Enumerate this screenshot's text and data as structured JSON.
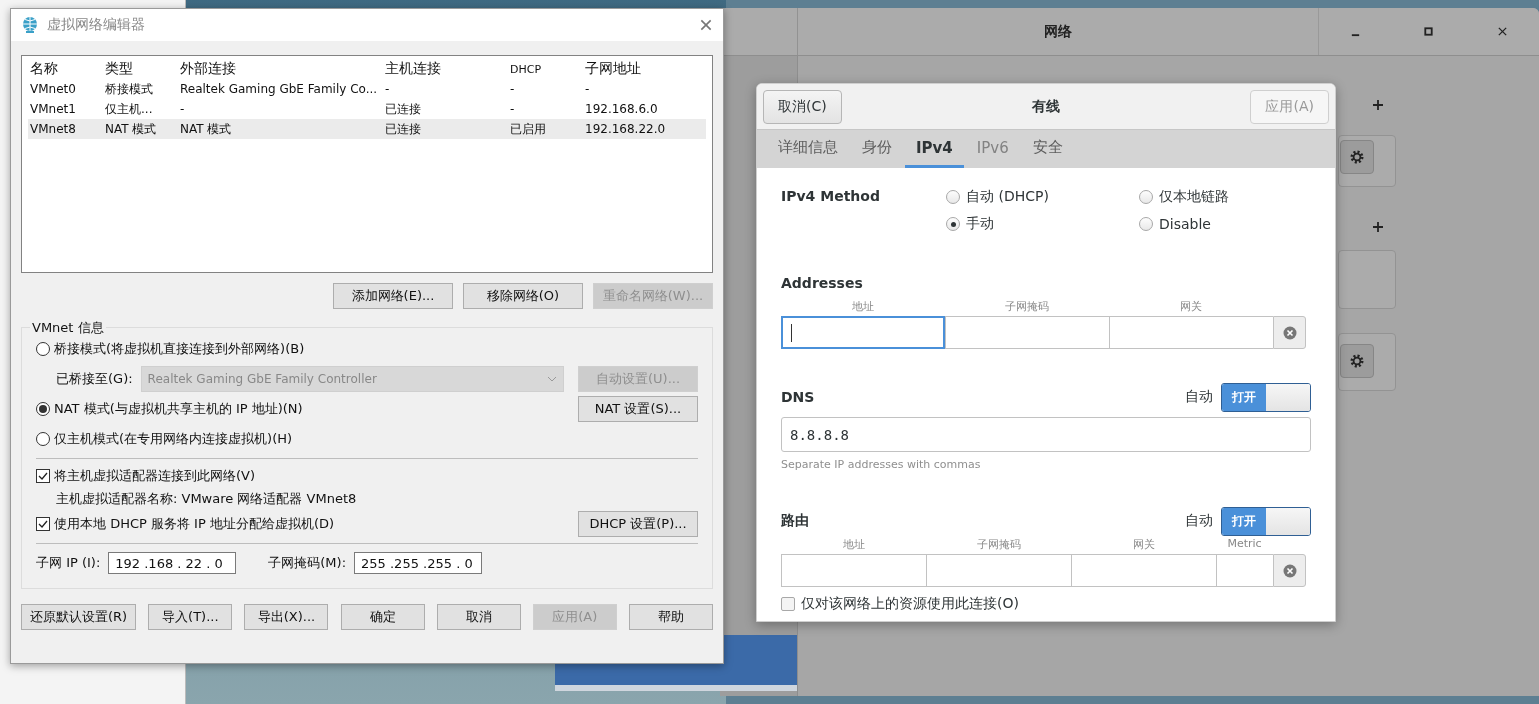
{
  "network_window": {
    "title": "网络"
  },
  "vnet_editor": {
    "title": "虚拟网络编辑器",
    "columns": [
      "名称",
      "类型",
      "外部连接",
      "主机连接",
      "DHCP",
      "子网地址"
    ],
    "rows": [
      {
        "cells": [
          "VMnet0",
          "桥接模式",
          "Realtek Gaming GbE Family Co...",
          "-",
          "-",
          "-"
        ],
        "selected": false
      },
      {
        "cells": [
          "VMnet1",
          "仅主机...",
          "-",
          "已连接",
          "-",
          "192.168.6.0"
        ],
        "selected": false
      },
      {
        "cells": [
          "VMnet8",
          "NAT 模式",
          "NAT 模式",
          "已连接",
          "已启用",
          "192.168.22.0"
        ],
        "selected": true
      }
    ],
    "list_buttons": [
      {
        "label": "添加网络(E)...",
        "disabled": false
      },
      {
        "label": "移除网络(O)",
        "disabled": false
      },
      {
        "label": "重命名网络(W)...",
        "disabled": true
      }
    ],
    "group_title": "VMnet 信息",
    "modes": [
      {
        "label": "桥接模式(将虚拟机直接连接到外部网络)(B)",
        "selected": false
      },
      {
        "label": "NAT 模式(与虚拟机共享主机的 IP 地址)(N)",
        "selected": true
      },
      {
        "label": "仅主机模式(在专用网络内连接虚拟机)(H)",
        "selected": false
      }
    ],
    "bridged_to": {
      "label": "已桥接至(G):",
      "value": "Realtek Gaming GbE Family Controller",
      "disabled": true
    },
    "auto_button": {
      "label": "自动设置(U)...",
      "disabled": true
    },
    "nat_button": {
      "label": "NAT 设置(S)...",
      "disabled": false
    },
    "options": [
      {
        "label": "将主机虚拟适配器连接到此网络(V)",
        "checked": true
      },
      {
        "label": "使用本地 DHCP 服务将 IP 地址分配给虚拟机(D)",
        "checked": true
      }
    ],
    "adapter_name": "主机虚拟适配器名称: VMware 网络适配器 VMnet8",
    "dhcp_button": {
      "label": "DHCP 设置(P)...",
      "disabled": false
    },
    "subnet_ip": {
      "label": "子网 IP (I):",
      "value": "192 .168 . 22 .  0"
    },
    "subnet_mask": {
      "label": "子网掩码(M):",
      "value": "255 .255 .255 .  0"
    },
    "footer_buttons": [
      {
        "label": "还原默认设置(R)",
        "disabled": false
      },
      {
        "label": "导入(T)...",
        "disabled": false
      },
      {
        "label": "导出(X)...",
        "disabled": false
      },
      {
        "label": "确定",
        "disabled": false
      },
      {
        "label": "取消",
        "disabled": false
      },
      {
        "label": "应用(A)",
        "disabled": true
      },
      {
        "label": "帮助",
        "disabled": false
      }
    ]
  },
  "wired_dialog": {
    "cancel_button": {
      "label": "取消(C)",
      "disabled": false
    },
    "title": "有线",
    "apply_button": {
      "label": "应用(A)",
      "disabled": true
    },
    "tabs": [
      {
        "label": "详细信息",
        "selected": false,
        "disabled": false
      },
      {
        "label": "身份",
        "selected": false,
        "disabled": false
      },
      {
        "label": "IPv4",
        "selected": true,
        "disabled": false
      },
      {
        "label": "IPv6",
        "selected": false,
        "disabled": true
      },
      {
        "label": "安全",
        "selected": false,
        "disabled": false
      }
    ],
    "method_label": "IPv4 Method",
    "methods": [
      {
        "label": "自动 (DHCP)",
        "selected": false
      },
      {
        "label": "仅本地链路",
        "selected": false
      },
      {
        "label": "手动",
        "selected": true
      },
      {
        "label": "Disable",
        "selected": false
      }
    ],
    "addresses": {
      "title": "Addresses",
      "columns": [
        "地址",
        "子网掩码",
        "网关"
      ]
    },
    "dns": {
      "title": "DNS",
      "auto_label": "自动",
      "switch": {
        "label": "打开",
        "on": true
      },
      "value": "8.8.8.8",
      "hint": "Separate IP addresses with commas"
    },
    "routes": {
      "title": "路由",
      "auto_label": "自动",
      "switch": {
        "label": "打开",
        "on": true
      },
      "columns": [
        "地址",
        "子网掩码",
        "网关",
        "Metric"
      ]
    },
    "only_local": {
      "label": "仅对该网络上的资源使用此连接(O)",
      "checked": false
    }
  }
}
